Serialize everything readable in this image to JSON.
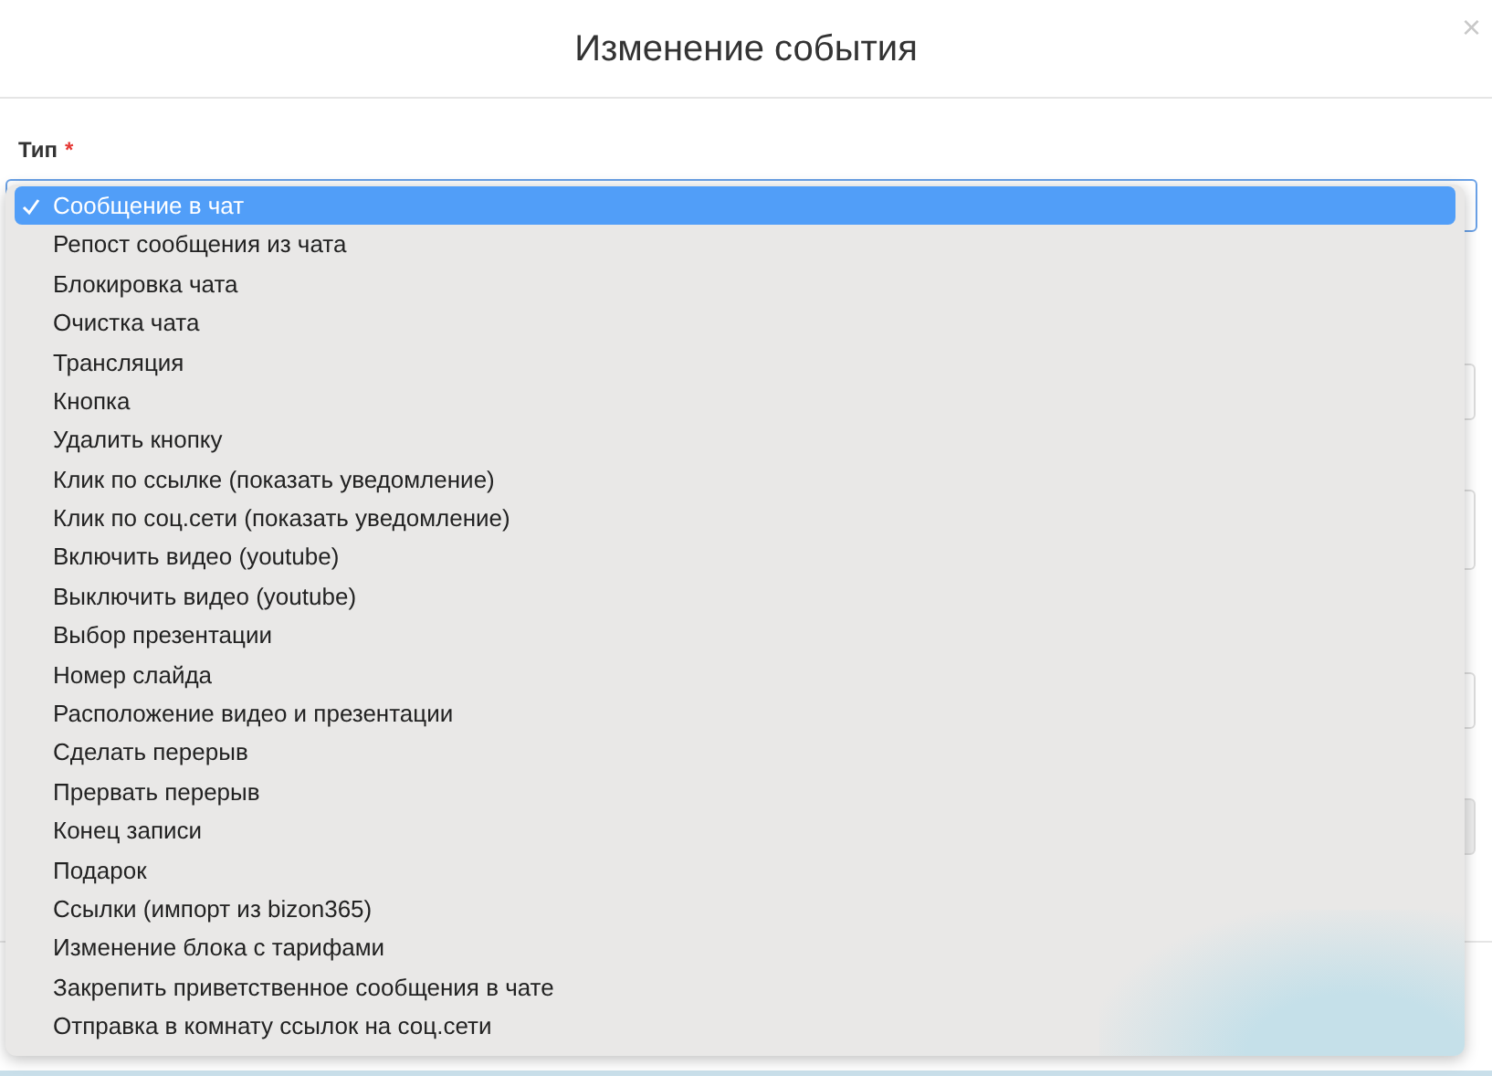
{
  "dialog": {
    "title": "Изменение события",
    "close": "×"
  },
  "field": {
    "label": "Тип",
    "required_mark": "*"
  },
  "dropdown": {
    "items": [
      {
        "label": "Сообщение в чат",
        "selected": true
      },
      {
        "label": "Репост сообщения из чата",
        "selected": false
      },
      {
        "label": "Блокировка чата",
        "selected": false
      },
      {
        "label": "Очистка чата",
        "selected": false
      },
      {
        "label": "Трансляция",
        "selected": false
      },
      {
        "label": "Кнопка",
        "selected": false
      },
      {
        "label": "Удалить кнопку",
        "selected": false
      },
      {
        "label": "Клик по ссылке (показать уведомление)",
        "selected": false
      },
      {
        "label": "Клик по соц.сети (показать уведомление)",
        "selected": false
      },
      {
        "label": "Включить видео (youtube)",
        "selected": false
      },
      {
        "label": "Выключить видео (youtube)",
        "selected": false
      },
      {
        "label": "Выбор презентации",
        "selected": false
      },
      {
        "label": "Номер слайда",
        "selected": false
      },
      {
        "label": "Расположение видео и презентации",
        "selected": false
      },
      {
        "label": "Сделать перерыв",
        "selected": false
      },
      {
        "label": "Прервать перерыв",
        "selected": false
      },
      {
        "label": "Конец записи",
        "selected": false
      },
      {
        "label": "Подарок",
        "selected": false
      },
      {
        "label": "Ссылки (импорт из bizon365)",
        "selected": false
      },
      {
        "label": "Изменение блока с тарифами",
        "selected": false
      },
      {
        "label": "Закрепить приветственное сообщения в чате",
        "selected": false
      },
      {
        "label": "Отправка в комнату ссылок на соц.сети",
        "selected": false
      }
    ]
  }
}
